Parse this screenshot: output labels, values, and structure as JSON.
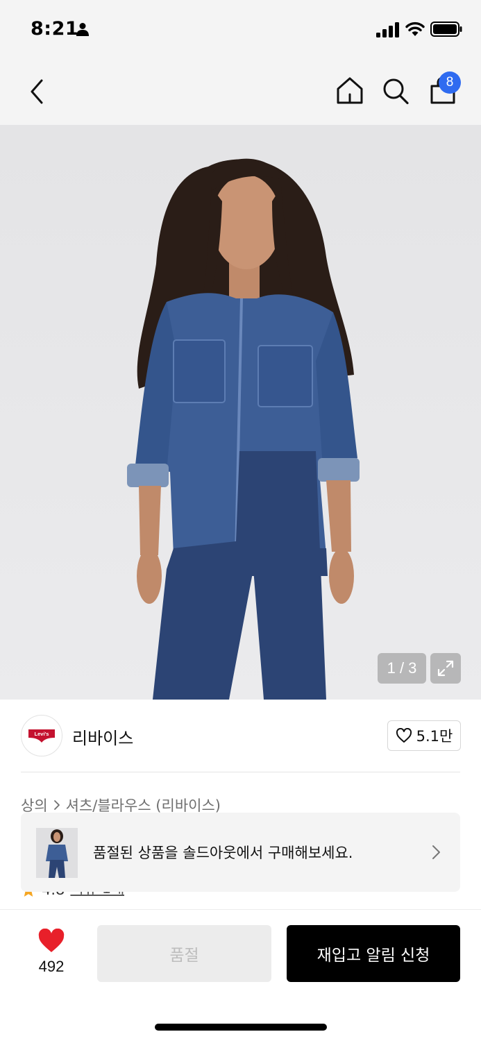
{
  "status_bar": {
    "time": "8:21",
    "icons": [
      "person-icon",
      "signal-icon",
      "wifi-icon",
      "battery-icon"
    ]
  },
  "nav": {
    "icons": [
      "back-icon",
      "home-icon",
      "search-icon",
      "shopping-bag-icon"
    ],
    "cart_count": "8"
  },
  "gallery": {
    "counter": "1 / 3",
    "expand_icon": "expand-icon"
  },
  "brand": {
    "logo_text": "Levi's",
    "name": "리바이스",
    "follow_count": "5.1만",
    "follow_icon": "heart-outline-icon"
  },
  "breadcrumb": {
    "category": "상의",
    "subcategory": "셔츠/블라우스 (리바이스)"
  },
  "rating": {
    "value": "4.8",
    "review_label": "리뷰 1개"
  },
  "soldout_banner": {
    "text": "품절된 상품을 솔드아웃에서 구매해보세요."
  },
  "bottom_bar": {
    "like_count": "492",
    "soldout_label": "품절",
    "restock_label": "재입고 알림 신청"
  },
  "colors": {
    "accent_blue": "#2f6bf0",
    "like_red": "#e8202a",
    "black": "#000000",
    "levis_red": "#c4122f"
  }
}
